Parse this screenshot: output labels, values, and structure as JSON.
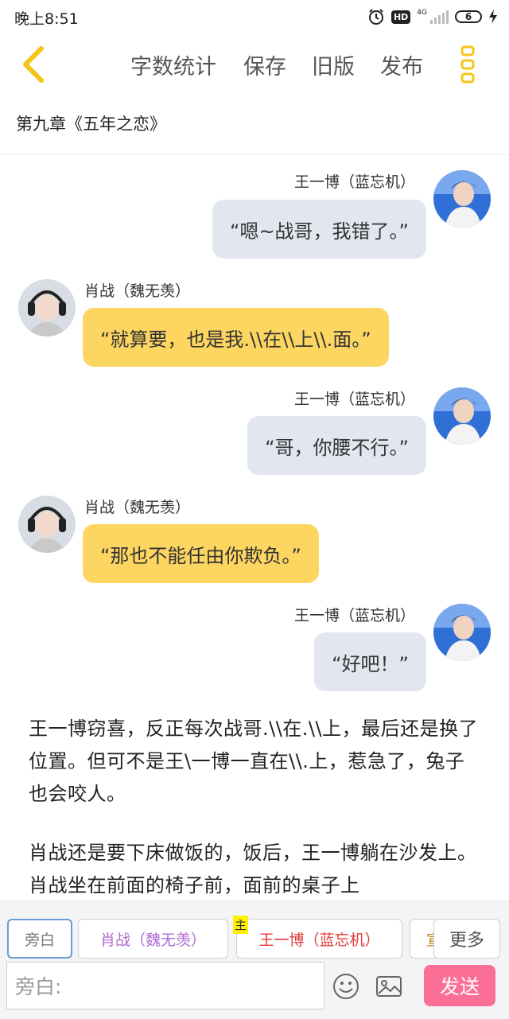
{
  "status_bar": {
    "time": "晚上8:51",
    "hd": "HD",
    "network": "4G",
    "battery": "6"
  },
  "header": {
    "menu": [
      {
        "label": "字数统计"
      },
      {
        "label": "保存"
      },
      {
        "label": "旧版"
      },
      {
        "label": "发布"
      }
    ],
    "chapter_title": "第九章《五年之恋》"
  },
  "messages": [
    {
      "speaker": "王一博（蓝忘机）",
      "text": "“嗯~战哥，我错了。”",
      "side": "right"
    },
    {
      "speaker": "肖战（魏无羡）",
      "text": "“就算要，也是我.\\\\在\\\\上\\\\.面。”",
      "side": "left"
    },
    {
      "speaker": "王一博（蓝忘机）",
      "text": "“哥，你腰不行。”",
      "side": "right"
    },
    {
      "speaker": "肖战（魏无羡）",
      "text": "“那也不能任由你欺负。”",
      "side": "left"
    },
    {
      "speaker": "王一博（蓝忘机）",
      "text": "“好吧！”",
      "side": "right"
    }
  ],
  "narration": [
    "王一博窃喜，反正每次战哥.\\\\在.\\\\上，最后还是换了位置。但可不是王\\一博一直在\\\\.上，惹急了，兔子也会咬人。",
    "肖战还是要下床做饭的，饭后，王一博躺在沙发上。肖战坐在前面的椅子前，面前的桌子上"
  ],
  "bottom": {
    "roles": [
      {
        "label": "旁白"
      },
      {
        "label": "肖战（魏无羡）"
      },
      {
        "label": "王一博（蓝忘机）",
        "tag": "主"
      },
      {
        "label": "宣"
      }
    ],
    "more_label": "更多",
    "input_value": "旁白:",
    "send_label": "发送"
  },
  "colors": {
    "accent_yellow": "#f5c518",
    "left_bubble": "#fdd561",
    "right_bubble": "#e2e7ef",
    "send_button": "#fb6f96",
    "role_purple": "#b06ad0",
    "role_red": "#e23b3b",
    "active_chip_border": "#6d9ad8"
  }
}
